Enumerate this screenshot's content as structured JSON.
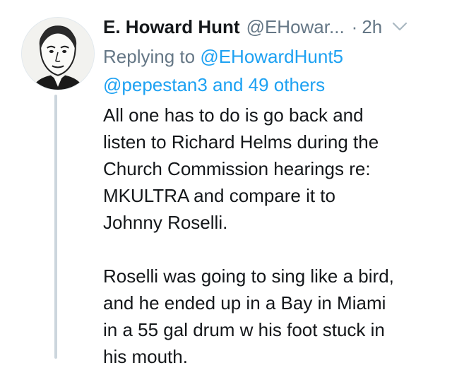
{
  "tweet": {
    "author_name": "E. Howard Hunt",
    "author_handle": "@EHowar...",
    "separator": "·",
    "time": "2h",
    "replying_prefix": "Replying to",
    "reply_to_handle": "@EHowardHunt5",
    "reply_to_others": "@pepestan3 and 49 others",
    "paragraph_1": [
      "All one has to do is go back and",
      "listen to Richard Helms during the",
      "Church Commission hearings re:",
      "MKULTRA and compare it to",
      "Johnny Roselli."
    ],
    "paragraph_2": [
      "Roselli was going to sing like a bird,",
      "and he ended up in a Bay in Miami",
      "in a 55 gal drum w his foot stuck in",
      "his mouth."
    ]
  },
  "icons": {
    "avatar": "sketch-portrait",
    "menu": "chevron-down-icon"
  },
  "colors": {
    "link": "#1da1f2",
    "secondary_text": "#657786",
    "thread_line": "#ccd6dd"
  }
}
